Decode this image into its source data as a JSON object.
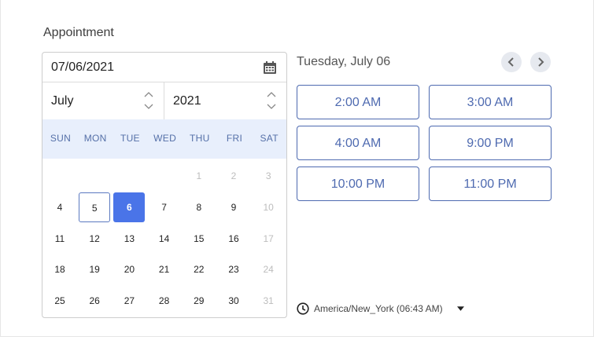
{
  "form": {
    "label": "Appointment"
  },
  "date_input": {
    "value": "07/06/2021"
  },
  "month_select": {
    "value": "July"
  },
  "year_select": {
    "value": "2021"
  },
  "weekdays": [
    "SUN",
    "MON",
    "TUE",
    "WED",
    "THU",
    "FRI",
    "SAT"
  ],
  "weeks": [
    [
      {
        "d": ""
      },
      {
        "d": ""
      },
      {
        "d": ""
      },
      {
        "d": ""
      },
      {
        "d": "1",
        "m": true
      },
      {
        "d": "2",
        "m": true
      },
      {
        "d": "3",
        "m": true
      }
    ],
    [
      {
        "d": "4"
      },
      {
        "d": "5",
        "today": true
      },
      {
        "d": "6",
        "sel": true
      },
      {
        "d": "7"
      },
      {
        "d": "8"
      },
      {
        "d": "9"
      },
      {
        "d": "10",
        "m": true
      }
    ],
    [
      {
        "d": "11"
      },
      {
        "d": "12"
      },
      {
        "d": "13"
      },
      {
        "d": "14"
      },
      {
        "d": "15"
      },
      {
        "d": "16"
      },
      {
        "d": "17",
        "m": true
      }
    ],
    [
      {
        "d": "18"
      },
      {
        "d": "19"
      },
      {
        "d": "20"
      },
      {
        "d": "21"
      },
      {
        "d": "22"
      },
      {
        "d": "23"
      },
      {
        "d": "24",
        "m": true
      }
    ],
    [
      {
        "d": "25"
      },
      {
        "d": "26"
      },
      {
        "d": "27"
      },
      {
        "d": "28"
      },
      {
        "d": "29"
      },
      {
        "d": "30"
      },
      {
        "d": "31",
        "m": true
      }
    ]
  ],
  "selected_date_heading": "Tuesday, July 06",
  "time_slots": [
    "2:00 AM",
    "3:00 AM",
    "4:00 AM",
    "9:00 PM",
    "10:00 PM",
    "11:00 PM"
  ],
  "timezone": {
    "label": "America/New_York (06:43 AM)"
  },
  "colors": {
    "accent": "#4a74e8",
    "slot_border": "#4e6ab0",
    "weekday_bg": "#e8effc"
  },
  "icons": {
    "date_input": "calendar-icon",
    "select_arrows": "chevron-up-down-icon",
    "prev": "chevron-left-icon",
    "next": "chevron-right-icon",
    "timezone": "clock-icon",
    "timezone_dropdown": "caret-down-icon"
  }
}
